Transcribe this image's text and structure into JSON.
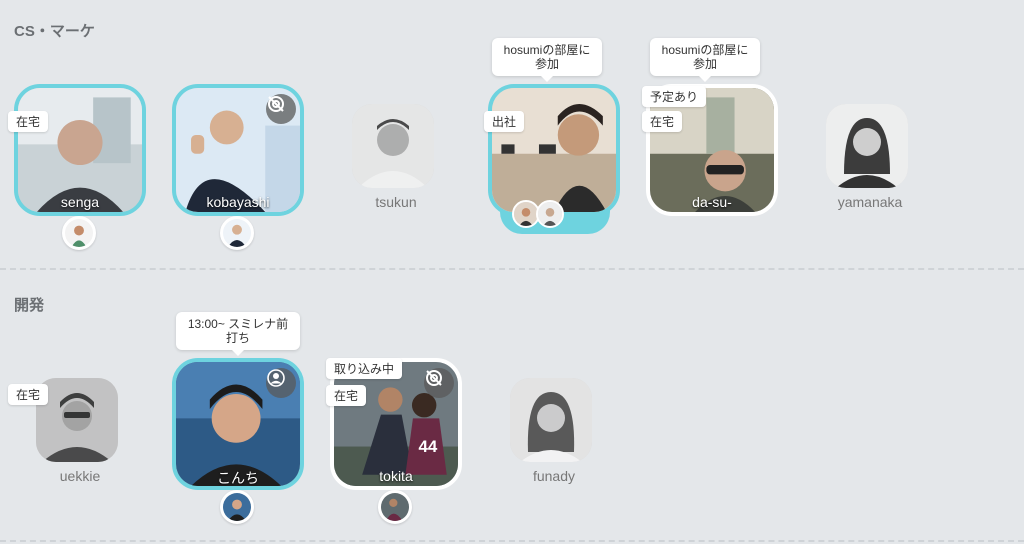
{
  "sections": [
    {
      "title": "CS・マーケ"
    },
    {
      "title": "開発"
    }
  ],
  "members": {
    "senga": {
      "name": "senga",
      "tag": "在宅"
    },
    "kobayashi": {
      "name": "kobayashi",
      "icon": "camera-off-icon"
    },
    "tsukun": {
      "name": "tsukun"
    },
    "hosumi": {
      "bubble": "hosumiの部屋に参加",
      "tag": "出社"
    },
    "dasu": {
      "name": "da-su-",
      "bubble": "hosumiの部屋に参加",
      "tag1": "予定あり",
      "tag2": "在宅"
    },
    "yamanaka": {
      "name": "yamanaka"
    },
    "uekkie": {
      "name": "uekkie",
      "tag": "在宅"
    },
    "konchi": {
      "name": "こんち",
      "bubble": "13:00~ スミレナ前打ち",
      "icon": "user-icon"
    },
    "tokita": {
      "name": "tokita",
      "tag1": "取り込み中",
      "tag2": "在宅",
      "icon": "camera-off-icon"
    },
    "funady": {
      "name": "funady"
    }
  },
  "colors": {
    "active_border": "#6ed3df",
    "background": "#e4e7ea"
  }
}
